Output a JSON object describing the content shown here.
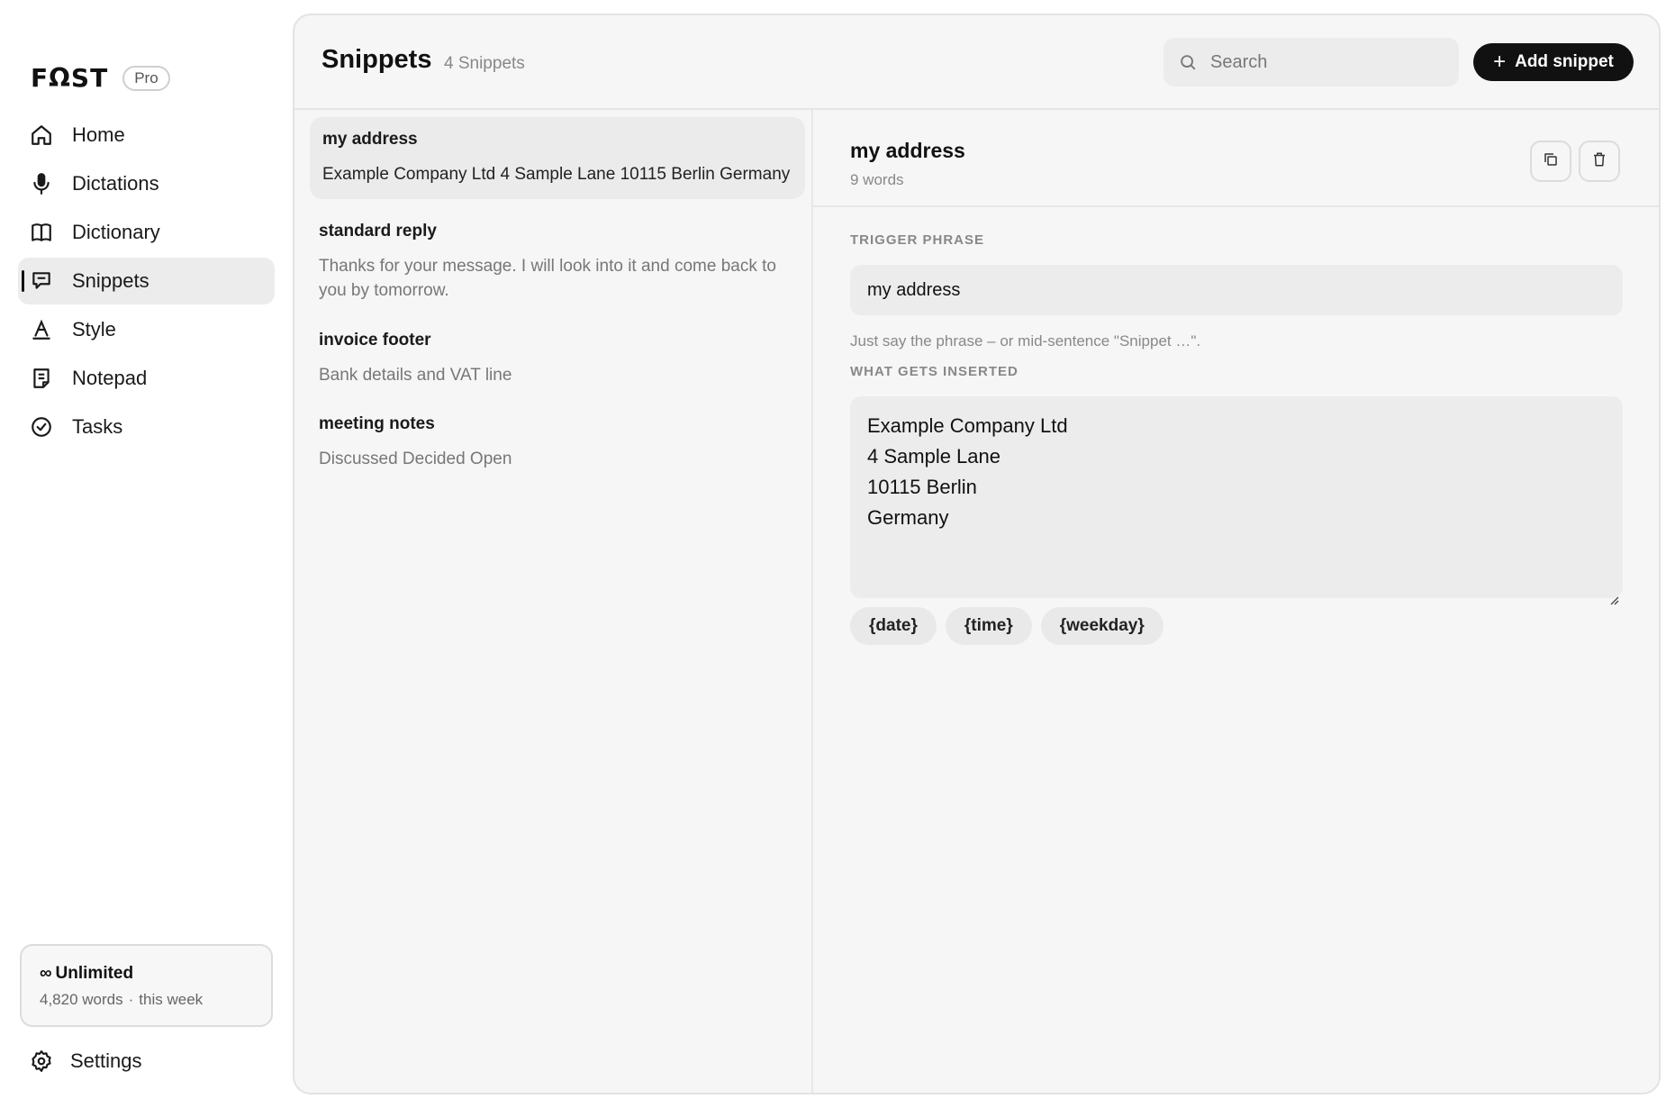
{
  "brand": {
    "logo": "FΩST",
    "plan_badge": "Pro"
  },
  "nav": {
    "items": [
      {
        "label": "Home",
        "icon": "home-icon"
      },
      {
        "label": "Dictations",
        "icon": "microphone-icon"
      },
      {
        "label": "Dictionary",
        "icon": "book-icon"
      },
      {
        "label": "Snippets",
        "icon": "snippets-icon",
        "active": true
      },
      {
        "label": "Style",
        "icon": "style-icon"
      },
      {
        "label": "Notepad",
        "icon": "notepad-icon"
      },
      {
        "label": "Tasks",
        "icon": "check-circle-icon"
      }
    ]
  },
  "usage": {
    "symbol": "∞",
    "plan": "Unlimited",
    "words": "4,820 words",
    "separator": "·",
    "period": "this week"
  },
  "settings": {
    "label": "Settings",
    "icon": "gear-icon"
  },
  "header": {
    "title": "Snippets",
    "count": "4 Snippets",
    "search_placeholder": "Search",
    "add_button": "Add snippet"
  },
  "snippets": [
    {
      "title": "my address",
      "preview": "Example Company Ltd 4 Sample Lane 10115 Berlin Germany",
      "selected": true
    },
    {
      "title": "standard reply",
      "preview": "Thanks for your message. I will look into it and come back to you by tomorrow."
    },
    {
      "title": "invoice footer",
      "preview": "Bank details and VAT line"
    },
    {
      "title": "meeting notes",
      "preview": "Discussed Decided Open"
    }
  ],
  "detail": {
    "title": "my address",
    "word_count": "9 words",
    "copy_icon": "copy-icon",
    "delete_icon": "trash-icon",
    "trigger_label": "TRIGGER PHRASE",
    "trigger_value": "my address",
    "hint": "Just say the phrase – or mid-sentence \"Snippet …\".",
    "insert_label": "WHAT GETS INSERTED",
    "insert_lines": [
      "Example Company Ltd",
      "4 Sample Lane",
      "10115 Berlin",
      "Germany"
    ],
    "variables": [
      "{date}",
      "{time}",
      "{weekday}"
    ]
  },
  "colors": {
    "accent": "#111111",
    "panel_bg": "#f6f6f6",
    "field_bg": "#ececec",
    "muted_text": "#888888"
  }
}
